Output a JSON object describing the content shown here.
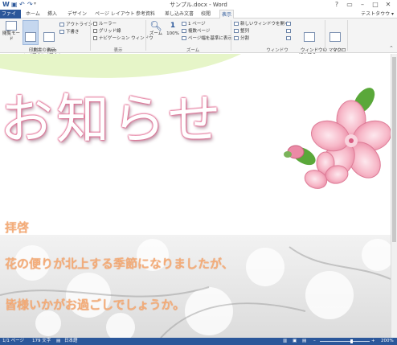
{
  "window": {
    "title": "サンプル.docx - Word",
    "controls": [
      "?",
      "▭",
      "–",
      "□",
      "✕"
    ]
  },
  "quick_access": [
    "W",
    "💾",
    "↶",
    "↷"
  ],
  "tabs": [
    {
      "label": "ファイル"
    },
    {
      "label": "ホーム"
    },
    {
      "label": "挿入"
    },
    {
      "label": "デザイン"
    },
    {
      "label": "ページ レイアウト"
    },
    {
      "label": "参考資料"
    },
    {
      "label": "差し込み文書"
    },
    {
      "label": "校閲"
    },
    {
      "label": "表示"
    }
  ],
  "user": "テストタウウ ▾",
  "ribbon": {
    "views": {
      "reading": "閲覧モード",
      "print": "印刷\nレイアウト",
      "web": "Web\nレイアウト",
      "outline": "アウトライン",
      "draft": "下書き",
      "label": "文書の表示"
    },
    "show": {
      "ruler": "ルーラー",
      "gridlines": "グリッド線",
      "nav_pane": "ナビゲーション ウィンドウ",
      "label": "表示"
    },
    "zoom": {
      "zoom": "ズーム",
      "percent": "100%",
      "one_page": "1 ページ",
      "multi_page": "複数ページ",
      "page_width": "ページ幅を基準に表示",
      "label": "ズーム"
    },
    "window": {
      "new_window": "新しいウィンドウを開く",
      "arrange": "整列",
      "split": "分割",
      "switch": "ウィンドウの\n切り替え ▾",
      "label": "ウィンドウ"
    },
    "macro": {
      "macro": "マクロ\n▾",
      "label": "マクロ"
    }
  },
  "document": {
    "heading": "お知らせ",
    "lines": [
      "拝啓",
      "花の便りが北上する季節になりましたが、",
      "皆様いかがお過ごしでしょうか。"
    ]
  },
  "status": {
    "page": "1/1 ページ",
    "words": "179 文字",
    "lang": "日本語",
    "zoom": "200%"
  },
  "colors": {
    "accent": "#2b579a",
    "heading_outline": "#e0638c",
    "body_text": "#f7b17e"
  }
}
